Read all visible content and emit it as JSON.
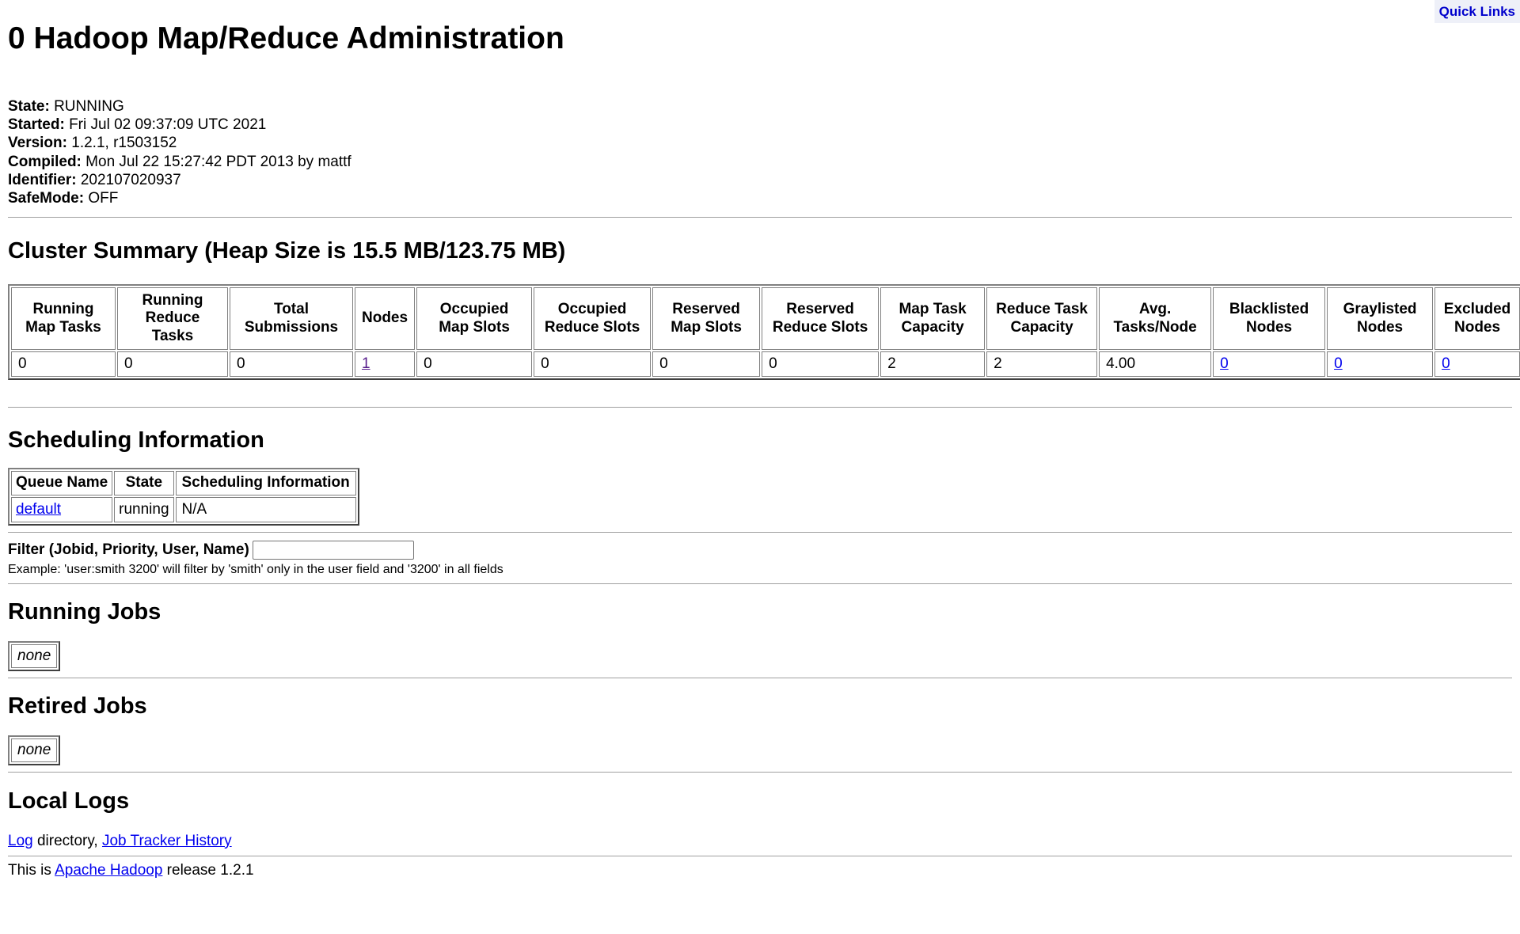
{
  "quick_links": "Quick Links",
  "title": "0 Hadoop Map/Reduce Administration",
  "info": [
    {
      "label": "State:",
      "value": "RUNNING"
    },
    {
      "label": "Started:",
      "value": "Fri Jul 02 09:37:09 UTC 2021"
    },
    {
      "label": "Version:",
      "value": "1.2.1, r1503152"
    },
    {
      "label": "Compiled:",
      "value": "Mon Jul 22 15:27:42 PDT 2013 by mattf"
    },
    {
      "label": "Identifier:",
      "value": "202107020937"
    },
    {
      "label": "SafeMode:",
      "value": "OFF"
    }
  ],
  "cluster_summary": {
    "heading": "Cluster Summary (Heap Size is 15.5 MB/123.75 MB)",
    "columns": [
      "Running Map Tasks",
      "Running Reduce Tasks",
      "Total Submissions",
      "Nodes",
      "Occupied Map Slots",
      "Occupied Reduce Slots",
      "Reserved Map Slots",
      "Reserved Reduce Slots",
      "Map Task Capacity",
      "Reduce Task Capacity",
      "Avg. Tasks/Node",
      "Blacklisted Nodes",
      "Graylisted Nodes",
      "Excluded Nodes"
    ],
    "values": [
      "0",
      "0",
      "0",
      "1",
      "0",
      "0",
      "0",
      "0",
      "2",
      "2",
      "4.00",
      "0",
      "0",
      "0"
    ]
  },
  "scheduling": {
    "heading": "Scheduling Information",
    "columns": [
      "Queue Name",
      "State",
      "Scheduling Information"
    ],
    "row": {
      "queue": "default",
      "state": "running",
      "info": "N/A"
    }
  },
  "filter": {
    "label": "Filter (Jobid, Priority, User, Name)",
    "value": "",
    "example": "Example: 'user:smith 3200' will filter by 'smith' only in the user field and '3200' in all fields"
  },
  "running_jobs": {
    "heading": "Running Jobs",
    "empty": "none"
  },
  "retired_jobs": {
    "heading": "Retired Jobs",
    "empty": "none"
  },
  "local_logs": {
    "heading": "Local Logs",
    "log_link": "Log",
    "directory_text": " directory, ",
    "history_link": "Job Tracker History"
  },
  "footer": {
    "prefix": "This is ",
    "link": "Apache Hadoop",
    "suffix": " release 1.2.1"
  }
}
